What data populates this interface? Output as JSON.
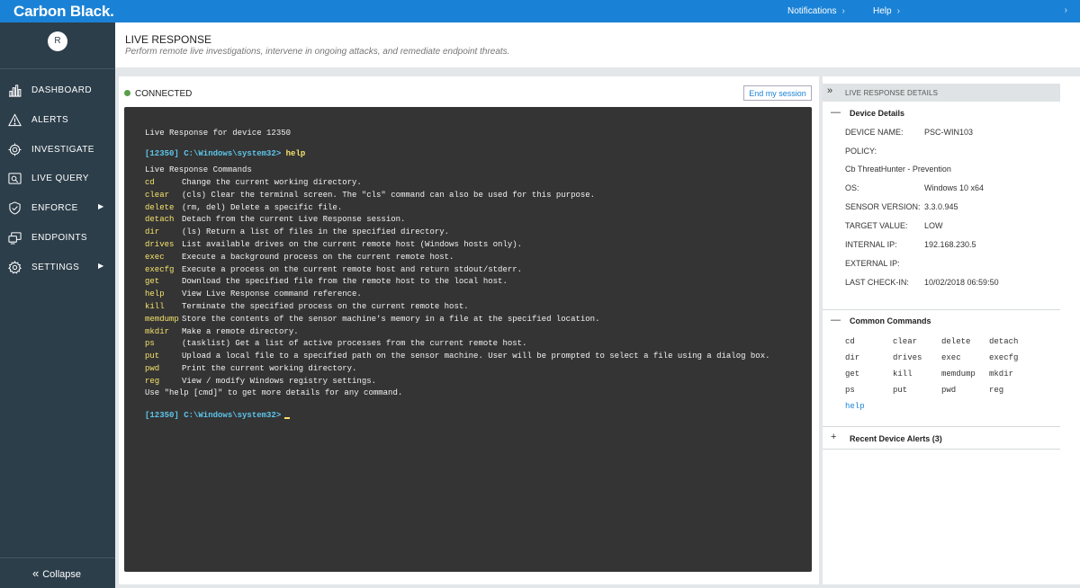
{
  "app": {
    "brand": "Carbon Black.",
    "notifications": "Notifications",
    "help": "Help",
    "chevron": "›"
  },
  "sidebar": {
    "avatar_initial": "R",
    "items": [
      {
        "label": "DASHBOARD",
        "icon": "bar-chart-icon",
        "has_submenu": false
      },
      {
        "label": "ALERTS",
        "icon": "warning-icon",
        "has_submenu": false
      },
      {
        "label": "INVESTIGATE",
        "icon": "crosshair-icon",
        "has_submenu": false
      },
      {
        "label": "LIVE QUERY",
        "icon": "query-icon",
        "has_submenu": false
      },
      {
        "label": "ENFORCE",
        "icon": "shield-check-icon",
        "has_submenu": true
      },
      {
        "label": "ENDPOINTS",
        "icon": "endpoints-icon",
        "has_submenu": false
      },
      {
        "label": "SETTINGS",
        "icon": "gear-icon",
        "has_submenu": true
      }
    ],
    "submenu_arrow": "▶",
    "collapse_label": "Collapse",
    "collapse_icon": "«"
  },
  "page": {
    "title": "LIVE RESPONSE",
    "subtitle": "Perform remote live investigations, intervene in ongoing attacks, and remediate endpoint threats."
  },
  "session": {
    "status": "CONNECTED",
    "status_color": "#5a9e4a",
    "end_button": "End my session"
  },
  "terminal": {
    "banner": "Live Response for device 12350",
    "prompt": "[12350] C:\\Windows\\system32>",
    "typed_command": "help",
    "commands_heading": "Live Response Commands",
    "commands": [
      {
        "name": "cd",
        "desc": "Change the current working directory."
      },
      {
        "name": "clear",
        "desc": "(cls) Clear the terminal screen. The \"cls\" command can also be used for this purpose."
      },
      {
        "name": "delete",
        "desc": "(rm, del) Delete a specific file."
      },
      {
        "name": "detach",
        "desc": "Detach from the current Live Response session."
      },
      {
        "name": "dir",
        "desc": "(ls) Return a list of files in the specified directory."
      },
      {
        "name": "drives",
        "desc": "List available drives on the current remote host (Windows hosts only)."
      },
      {
        "name": "exec",
        "desc": "Execute a background process on the current remote host."
      },
      {
        "name": "execfg",
        "desc": "Execute a process on the current remote host and return stdout/stderr."
      },
      {
        "name": "get",
        "desc": "Download the specified file from the remote host to the local host."
      },
      {
        "name": "help",
        "desc": "View Live Response command reference."
      },
      {
        "name": "kill",
        "desc": "Terminate the specified process on the current remote host."
      },
      {
        "name": "memdump",
        "desc": "Store the contents of the sensor machine's memory in a file at the specified location."
      },
      {
        "name": "mkdir",
        "desc": "Make a remote directory."
      },
      {
        "name": "ps",
        "desc": "(tasklist) Get a list of active processes from the current remote host."
      },
      {
        "name": "put",
        "desc": "Upload a local file to a specified path on the sensor machine. User will be prompted to select a file using a dialog box."
      },
      {
        "name": "pwd",
        "desc": "Print the current working directory."
      },
      {
        "name": "reg",
        "desc": "View / modify Windows registry settings."
      }
    ],
    "footer_hint": "Use \"help [cmd]\" to get more details for any command.",
    "colors": {
      "prompt": "#5cc4ea",
      "command": "#f5e36c",
      "background": "#343434"
    }
  },
  "details_panel": {
    "header": "LIVE RESPONSE DETAILS",
    "header_icon": "»",
    "device_section": {
      "title": "Device Details",
      "toggle": "—",
      "fields": [
        {
          "label": "DEVICE NAME:",
          "value": "PSC-WIN103"
        },
        {
          "label": "POLICY:",
          "value": ""
        },
        {
          "label": "Cb ThreatHunter - Prevention",
          "value": ""
        },
        {
          "label": "OS:",
          "value": "Windows 10 x64"
        },
        {
          "label": "SENSOR VERSION:",
          "value": "3.3.0.945"
        },
        {
          "label": "TARGET VALUE:",
          "value": "LOW"
        },
        {
          "label": "INTERNAL IP:",
          "value": "192.168.230.5"
        },
        {
          "label": "EXTERNAL IP:",
          "value": ""
        },
        {
          "label": "LAST CHECK-IN:",
          "value": "10/02/2018 06:59:50"
        }
      ]
    },
    "common_commands": {
      "title": "Common Commands",
      "toggle": "—",
      "rows": [
        [
          "cd",
          "clear",
          "delete",
          "detach"
        ],
        [
          "dir",
          "drives",
          "exec",
          "execfg"
        ],
        [
          "get",
          "kill",
          "memdump",
          "mkdir"
        ],
        [
          "ps",
          "put",
          "pwd",
          "reg"
        ],
        [
          "help"
        ]
      ]
    },
    "alerts_section": {
      "title": "Recent Device Alerts (3)",
      "toggle": "+"
    }
  }
}
